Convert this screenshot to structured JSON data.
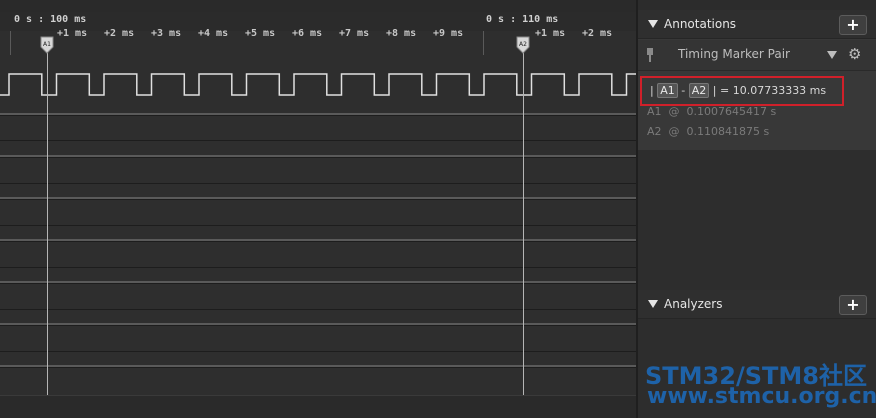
{
  "ruler": {
    "major_left": "0 s : 100 ms",
    "major_right": "0 s : 110 ms",
    "ticks_left": [
      "+1 ms",
      "+2 ms",
      "+3 ms",
      "+4 ms",
      "+5 ms",
      "+6 ms",
      "+7 ms",
      "+8 ms",
      "+9 ms"
    ],
    "ticks_right": [
      "+1 ms",
      "+2 ms"
    ]
  },
  "markers": {
    "a1": "A1",
    "a2": "A2"
  },
  "annotations_panel": {
    "title": "Annotations",
    "add_label": "+",
    "marker_pair": {
      "label": "Timing Marker Pair"
    },
    "measurement": {
      "pipe_open": "|",
      "a1": "A1",
      "minus": "-",
      "a2": "A2",
      "pipe_close": "|",
      "equals": "=",
      "value": "10.07733333 ms"
    },
    "details": [
      {
        "marker": "A1",
        "at": "@",
        "value": "0.1007645417 s"
      },
      {
        "marker": "A2",
        "at": "@",
        "value": "0.110841875 s"
      }
    ]
  },
  "analyzers_panel": {
    "title": "Analyzers",
    "add_label": "+"
  },
  "watermark": {
    "line1": "STM32/STM8社区",
    "line2": "www.stmcu.org.cn"
  },
  "colors": {
    "highlight_box": "#d0202a",
    "watermark": "#1e62a8",
    "signal": "#e0e0e0"
  },
  "icons": {
    "collapse": "triangle-down-icon",
    "add": "plus-icon",
    "pin": "pin-icon",
    "settings": "gear-icon",
    "marker_flag": "marker-flag-icon"
  }
}
